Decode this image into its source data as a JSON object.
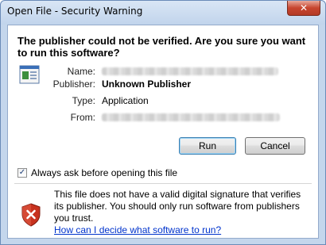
{
  "window": {
    "title": "Open File - Security Warning",
    "close_label": "✕"
  },
  "dialog": {
    "heading": "The publisher could not be verified.  Are you sure you want to run this software?",
    "fields": {
      "name_label": "Name:",
      "publisher_label": "Publisher:",
      "publisher_value": "Unknown Publisher",
      "type_label": "Type:",
      "type_value": "Application",
      "from_label": "From:"
    },
    "buttons": {
      "run": "Run",
      "cancel": "Cancel"
    },
    "checkbox": {
      "label": "Always ask before opening this file",
      "checked": true,
      "mark": "✓"
    },
    "warning": {
      "text": "This file does not have a valid digital signature that verifies its publisher.  You should only run software from publishers you trust.",
      "link": "How can I decide what software to run?"
    }
  },
  "colors": {
    "titlebar": "#c4d6ec",
    "link": "#0033cc",
    "shield_red": "#c8321e"
  },
  "icons": {
    "app": "application-icon",
    "warning": "shield-warning-icon",
    "close": "close-icon"
  }
}
